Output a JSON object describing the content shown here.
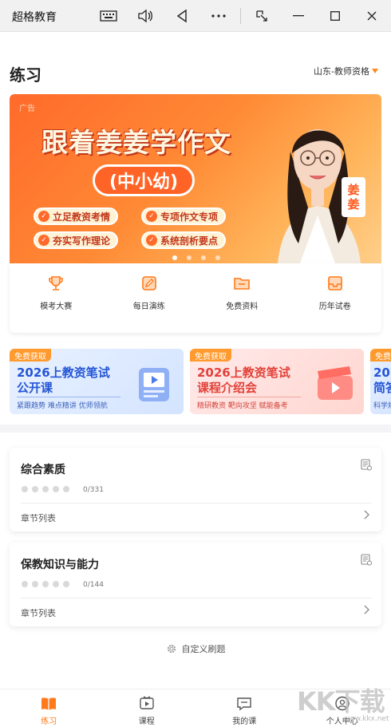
{
  "window": {
    "title": "超格教育",
    "controls": [
      "keyboard-icon",
      "volume-icon",
      "back-triangle-icon",
      "more-icon",
      "snap-icon",
      "minimize-icon",
      "maximize-icon",
      "close-icon"
    ]
  },
  "header": {
    "title": "练习",
    "region": "山东-教师资格"
  },
  "banner": {
    "ad_tag": "广告",
    "headline": "跟着姜姜学作文",
    "sub": "(中小幼)",
    "points": [
      "立足教资考情",
      "专项作文专项",
      "夯实写作理论",
      "系统剖析要点"
    ],
    "name_tag": [
      "姜",
      "姜"
    ],
    "slides": 4,
    "active_slide": 0
  },
  "quick_entries": [
    {
      "label": "模考大赛",
      "icon": "trophy-icon"
    },
    {
      "label": "每日演练",
      "icon": "edit-icon"
    },
    {
      "label": "免费资料",
      "icon": "folder-icon"
    },
    {
      "label": "历年试卷",
      "icon": "inbox-icon"
    }
  ],
  "promos": [
    {
      "badge": "免费获取",
      "title": [
        "2026上教资笔试",
        "公开课"
      ],
      "desc": "紧跟趋势 难点精讲 优师领航"
    },
    {
      "badge": "免费获取",
      "title": [
        "2026上教资笔试",
        "课程介绍会"
      ],
      "desc": "精研教资 靶向攻坚 赋能备考"
    },
    {
      "badge": "免费",
      "title": [
        "202",
        "简答"
      ],
      "desc": "科学规"
    }
  ],
  "subjects": [
    {
      "title": "综合素质",
      "count": "0/331",
      "chapter_label": "章节列表"
    },
    {
      "title": "保教知识与能力",
      "count": "0/144",
      "chapter_label": "章节列表"
    }
  ],
  "custom_label": "自定义刷题",
  "bottom_nav": [
    {
      "label": "练习",
      "icon": "book-icon",
      "active": true
    },
    {
      "label": "课程",
      "icon": "video-icon",
      "active": false
    },
    {
      "label": "我的课",
      "icon": "chat-icon",
      "active": false
    },
    {
      "label": "个人中心",
      "icon": "user-icon",
      "active": false
    }
  ],
  "watermark": {
    "text": "KK下载",
    "site": "www.kkx.net"
  },
  "colors": {
    "accent": "#ff7a1a",
    "banner": "#ff6a2b"
  }
}
